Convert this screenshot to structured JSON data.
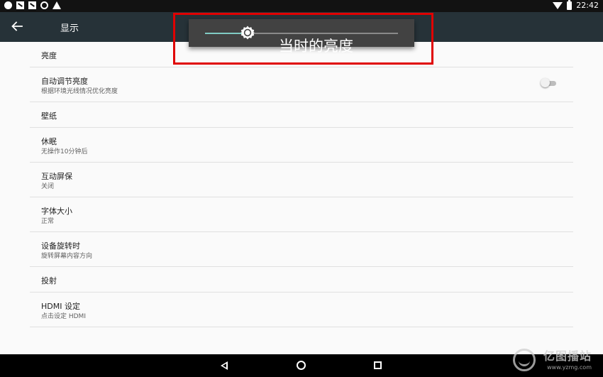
{
  "status_bar": {
    "time": "22:42",
    "left_icons": [
      "dot-icon",
      "image-icon",
      "image-icon",
      "android-icon",
      "home-icon"
    ],
    "right_icons": [
      "wifi-icon",
      "battery-icon"
    ]
  },
  "app_bar": {
    "title": "显示",
    "back_icon": "arrow-left-icon",
    "background": "#263238"
  },
  "settings": {
    "items": [
      {
        "title": "亮度",
        "summary": ""
      },
      {
        "title": "自动调节亮度",
        "summary": "根据环境光线情况优化亮度",
        "toggle": false
      },
      {
        "title": "壁纸",
        "summary": ""
      },
      {
        "title": "休眠",
        "summary": "无操作10分钟后"
      },
      {
        "title": "互动屏保",
        "summary": "关闭"
      },
      {
        "title": "字体大小",
        "summary": "正常"
      },
      {
        "title": "设备旋转时",
        "summary": "旋转屏幕内容方向"
      },
      {
        "title": "投射",
        "summary": ""
      },
      {
        "title": "HDMI 设定",
        "summary": "点击设定 HDMI"
      }
    ]
  },
  "brightness_popup": {
    "label": "当时的亮度",
    "level": 0.22,
    "thumb_icon": "brightness-sun-icon",
    "accent": "#80cbc4"
  },
  "annotation": {
    "color": "#e00000"
  },
  "nav_bar": {
    "buttons": [
      "nav-back-icon",
      "nav-home-icon",
      "nav-recents-icon"
    ]
  },
  "watermark": {
    "brand": "亿图播站",
    "url": "www.yzmg.com"
  }
}
